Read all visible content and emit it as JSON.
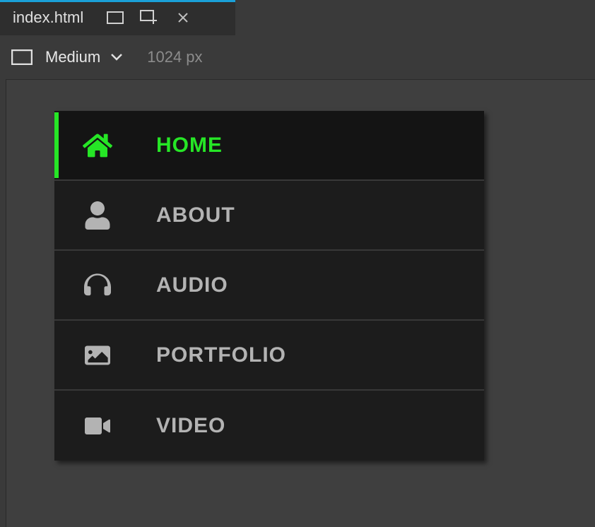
{
  "tab": {
    "title": "index.html"
  },
  "viewport": {
    "name": "Medium",
    "pixels": "1024 px"
  },
  "menu": {
    "items": [
      {
        "label": "HOME",
        "icon": "home-icon",
        "active": true
      },
      {
        "label": "ABOUT",
        "icon": "user-icon",
        "active": false
      },
      {
        "label": "AUDIO",
        "icon": "headphones-icon",
        "active": false
      },
      {
        "label": "PORTFOLIO",
        "icon": "image-icon",
        "active": false
      },
      {
        "label": "VIDEO",
        "icon": "video-icon",
        "active": false
      }
    ]
  },
  "colors": {
    "accent_tab": "#1aa0d8",
    "accent_menu": "#26e626"
  }
}
